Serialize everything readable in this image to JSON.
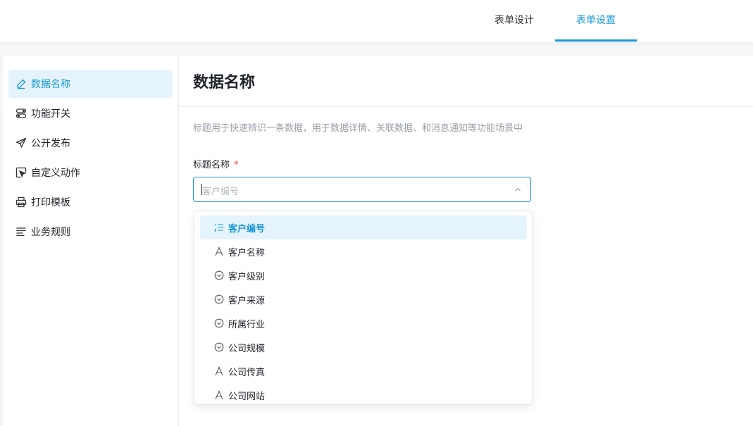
{
  "tabs": [
    {
      "label": "表单设计",
      "active": false
    },
    {
      "label": "表单设置",
      "active": true
    }
  ],
  "sidebar": {
    "items": [
      {
        "label": "数据名称",
        "icon": "edit-icon",
        "active": true
      },
      {
        "label": "功能开关",
        "icon": "toggle-icon",
        "active": false
      },
      {
        "label": "公开发布",
        "icon": "send-icon",
        "active": false
      },
      {
        "label": "自定义动作",
        "icon": "cursor-box-icon",
        "active": false
      },
      {
        "label": "打印模板",
        "icon": "printer-icon",
        "active": false
      },
      {
        "label": "业务规则",
        "icon": "lines-icon",
        "active": false
      }
    ]
  },
  "main": {
    "title": "数据名称",
    "description": "标题用于快速辨识一条数据，用于数据详情、关联数据、和消息通知等功能场景中",
    "field_label": "标题名称",
    "required_mark": "*",
    "select_placeholder": "客户编号"
  },
  "dropdown": {
    "options": [
      {
        "label": "客户编号",
        "icon": "numbered-list-icon",
        "selected": true
      },
      {
        "label": "客户名称",
        "icon": "text-a-icon",
        "selected": false
      },
      {
        "label": "客户级别",
        "icon": "select-circle-icon",
        "selected": false
      },
      {
        "label": "客户来源",
        "icon": "select-circle-icon",
        "selected": false
      },
      {
        "label": "所属行业",
        "icon": "select-circle-icon",
        "selected": false
      },
      {
        "label": "公司规模",
        "icon": "select-circle-icon",
        "selected": false
      },
      {
        "label": "公司传真",
        "icon": "text-a-icon",
        "selected": false
      },
      {
        "label": "公司网站",
        "icon": "text-a-icon",
        "selected": false
      }
    ]
  },
  "colors": {
    "accent": "#1a98d5",
    "active_bg": "#e5f4fc",
    "required": "#f04848"
  }
}
